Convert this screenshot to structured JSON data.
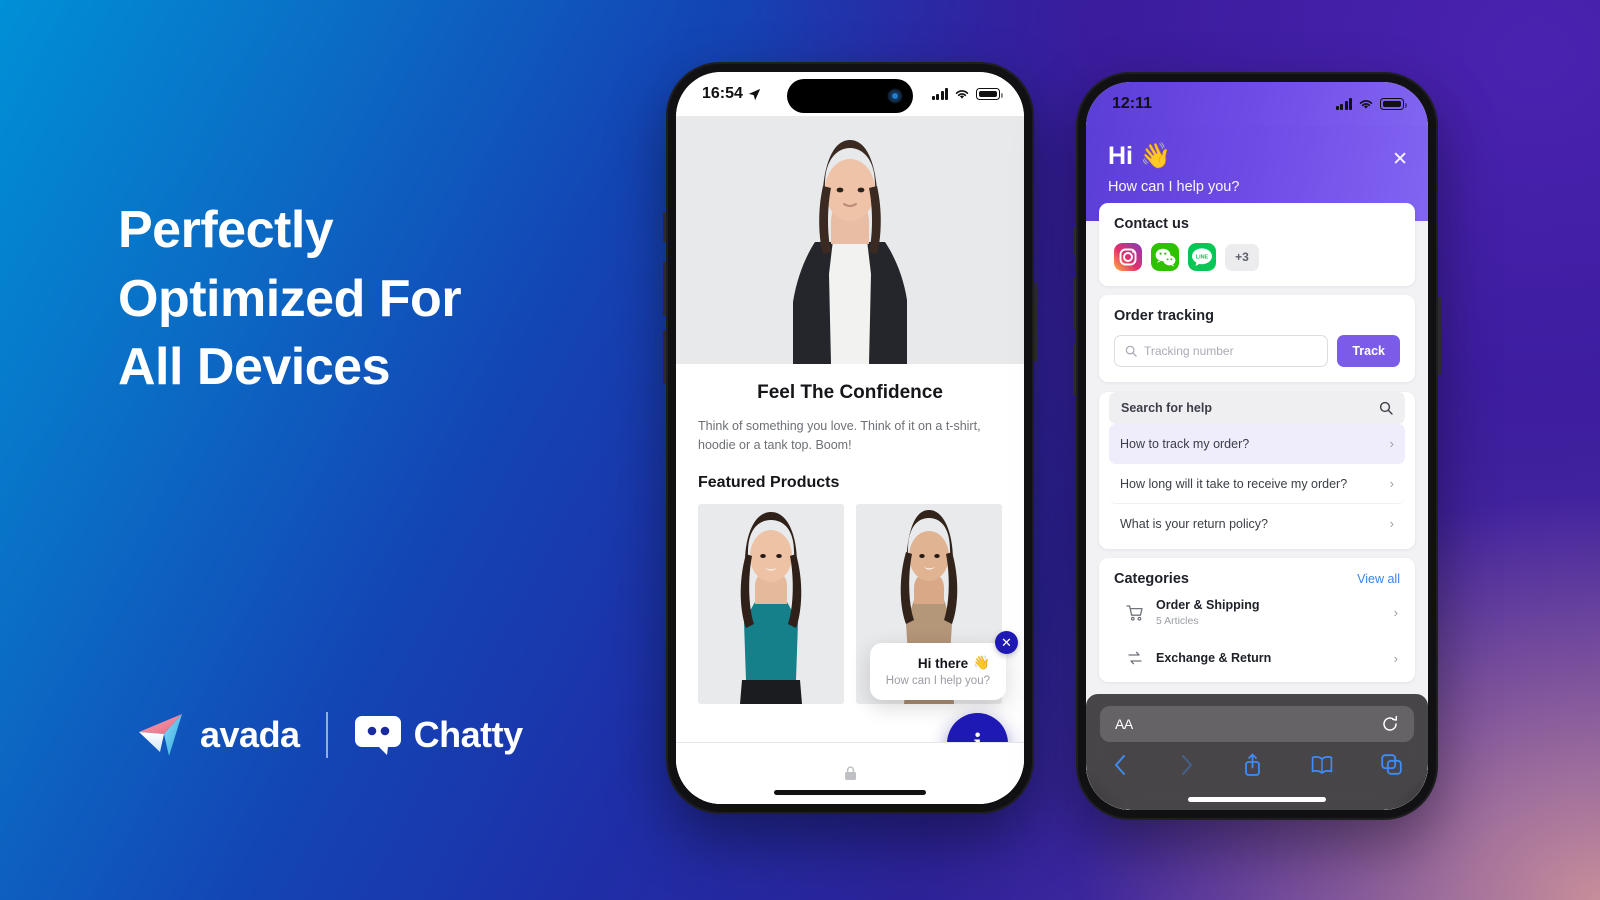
{
  "background": {
    "gradient_from": "#0090D6",
    "gradient_mid": "#1E2FA8",
    "gradient_to": "#3A1F9E",
    "glow": "#ECAA96"
  },
  "hero": {
    "headline_line1": "Perfectly",
    "headline_line2": "Optimized For",
    "headline_line3": "All Devices"
  },
  "brand": {
    "avada_name": "avada",
    "chatty_name": "Chatty",
    "plane_icon": "paper-plane-icon",
    "chat_icon": "chat-bubble-icon",
    "accent_pink": "#F08A9E",
    "accent_cyan": "#45C8F0"
  },
  "phone_left": {
    "status": {
      "time": "16:54",
      "location_icon": "location-arrow-icon",
      "signal_icon": "cellular-signal-icon",
      "wifi_icon": "wifi-icon",
      "battery_icon": "battery-icon"
    },
    "store": {
      "title": "Feel The Confidence",
      "subtitle": "Think of something you love. Think of it on a t-shirt, hoodie or a tank top. Boom!",
      "featured_label": "Featured Products",
      "products": [
        {
          "name": "Teal ribbed tank top",
          "color": "#157F8A"
        },
        {
          "name": "Beige camisole and trousers",
          "color": "#B49679"
        }
      ]
    },
    "teaser": {
      "title": "Hi there",
      "emoji": "👋",
      "subtitle": "How can I help you?",
      "close_icon": "close-icon",
      "fab_icon": "info-icon",
      "fab_color": "#1E18B5"
    },
    "browser": {
      "lock_icon": "lock-icon"
    }
  },
  "phone_right": {
    "status": {
      "time": "12:11",
      "signal_icon": "cellular-signal-icon",
      "wifi_icon": "wifi-icon",
      "battery_icon": "battery-icon"
    },
    "header": {
      "greeting": "Hi",
      "emoji": "👋",
      "subtitle": "How can I help you?",
      "close_icon": "close-icon",
      "gradient_from": "#5B3ED6",
      "gradient_to": "#8265F2"
    },
    "contact": {
      "title": "Contact us",
      "channels": [
        {
          "name": "instagram-icon",
          "label": "Instagram"
        },
        {
          "name": "wechat-icon",
          "label": "WeChat"
        },
        {
          "name": "line-icon",
          "label": "LINE"
        }
      ],
      "more_label": "+3"
    },
    "order_tracking": {
      "title": "Order tracking",
      "input_placeholder": "Tracking number",
      "input_value": "",
      "search_icon": "search-icon",
      "button_label": "Track",
      "button_color": "#7B5CE8"
    },
    "help": {
      "search_label": "Search for help",
      "search_icon": "search-icon",
      "items": [
        {
          "label": "How to track my order?",
          "active": true
        },
        {
          "label": "How long will it take to receive my order?",
          "active": false
        },
        {
          "label": "What is your return policy?",
          "active": false
        }
      ]
    },
    "categories": {
      "title": "Categories",
      "view_all_label": "View all",
      "items": [
        {
          "name": "Order & Shipping",
          "count": "5 Articles",
          "icon": "shopping-cart-icon"
        },
        {
          "name": "Exchange & Return",
          "count": "",
          "icon": "exchange-arrows-icon"
        }
      ]
    },
    "safari": {
      "aa_label": "AA",
      "reload_icon": "reload-icon",
      "back_icon": "chevron-left-icon",
      "forward_icon": "chevron-right-icon",
      "share_icon": "share-icon",
      "bookmarks_icon": "book-icon",
      "tabs_icon": "tabs-icon"
    }
  }
}
